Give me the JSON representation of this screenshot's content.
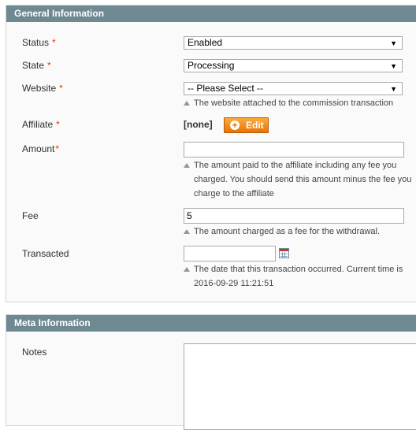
{
  "general": {
    "title": "General Information",
    "status": {
      "label": "Status",
      "value": "Enabled"
    },
    "state": {
      "label": "State",
      "value": "Processing"
    },
    "website": {
      "label": "Website",
      "value": "-- Please Select --",
      "note": "The website attached to the commission transaction"
    },
    "affiliate": {
      "label": "Affiliate",
      "value": "[none]",
      "edit_label": "Edit"
    },
    "amount": {
      "label": "Amount",
      "value": "",
      "note_lines": [
        "The amount paid to the affiliate including any fee you",
        "charged. You should send this amount minus the fee you",
        "charge to the affiliate"
      ]
    },
    "fee": {
      "label": "Fee",
      "value": "5",
      "note": "The amount charged as a fee for the withdrawal."
    },
    "transacted": {
      "label": "Transacted",
      "value": "",
      "note_lines": [
        "The date that this transaction occurred. Current time is",
        "2016-09-29 11:21:51"
      ]
    }
  },
  "meta": {
    "title": "Meta Information",
    "notes": {
      "label": "Notes",
      "value": ""
    }
  },
  "required_marker": "*"
}
